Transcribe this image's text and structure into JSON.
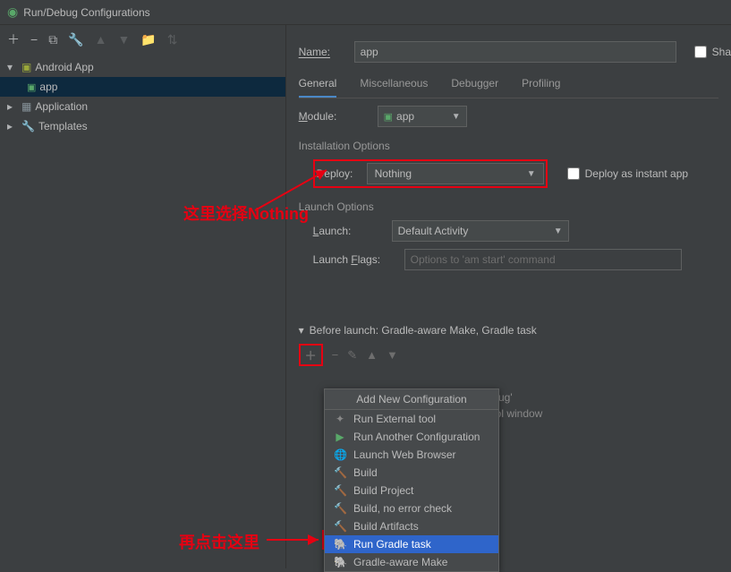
{
  "window_title": "Run/Debug Configurations",
  "tree": {
    "items": [
      {
        "label": "Android App",
        "icon": "android"
      },
      {
        "label": "app",
        "icon": "app",
        "selected": true
      },
      {
        "label": "Application",
        "icon": "folder"
      },
      {
        "label": "Templates",
        "icon": "folder"
      }
    ]
  },
  "form": {
    "name_label": "Name:",
    "name_value": "app",
    "share_label": "Sha",
    "tabs": [
      "General",
      "Miscellaneous",
      "Debugger",
      "Profiling"
    ],
    "module_label": "Module:",
    "module_value": "app",
    "installation_header": "Installation Options",
    "deploy_label": "Deploy:",
    "deploy_value": "Nothing",
    "deploy_instant": "Deploy as instant app",
    "launch_header": "Launch Options",
    "launch_label": "Launch:",
    "launch_value": "Default Activity",
    "flags_label": "Launch Flags:",
    "flags_placeholder": "Options to 'am start' command",
    "before_launch_label": "Before launch: Gradle-aware Make, Gradle task",
    "bl_extra1": "ebug'",
    "bl_extra2": "tool window"
  },
  "popup": {
    "title": "Add New Configuration",
    "items": [
      {
        "label": "Run External tool",
        "icon": "wrench"
      },
      {
        "label": "Run Another Configuration",
        "icon": "play"
      },
      {
        "label": "Launch Web Browser",
        "icon": "globe"
      },
      {
        "label": "Build",
        "icon": "hammer"
      },
      {
        "label": "Build Project",
        "icon": "hammer"
      },
      {
        "label": "Build, no error check",
        "icon": "hammer"
      },
      {
        "label": "Build Artifacts",
        "icon": "hammer"
      },
      {
        "label": "Run Gradle task",
        "icon": "elephant",
        "selected": true
      },
      {
        "label": "Gradle-aware Make",
        "icon": "elephant"
      }
    ]
  },
  "annotations": {
    "a1": "这里选择Nothing",
    "a2": "再点击这里"
  }
}
